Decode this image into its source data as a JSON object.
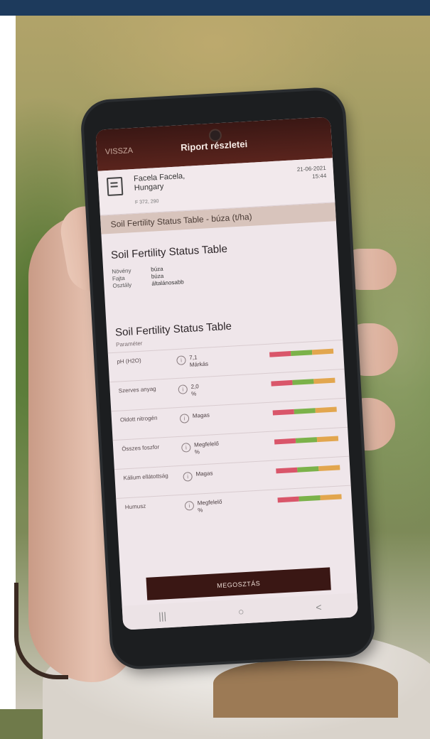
{
  "app": {
    "back_label": "VISSZA",
    "title": "Riport részletei"
  },
  "report": {
    "location_line1": "Facela Facela,",
    "location_line2": "Hungary",
    "coordinates": "F 372, 290",
    "date": "21-06-2021",
    "time": "15:44"
  },
  "section_header": "Soil Fertility Status Table - búza (t/ha)",
  "summary": {
    "title": "Soil Fertility Status Table",
    "rows": [
      {
        "key": "Növény",
        "value": "búza"
      },
      {
        "key": "Fajta",
        "value": "búza"
      },
      {
        "key": "Osztály",
        "value": "általánosabb"
      }
    ]
  },
  "table": {
    "title": "Soil Fertility Status Table",
    "column_label": "Paraméter",
    "rows": [
      {
        "name": "pH (H2O)",
        "value": "7,1\nMárkás"
      },
      {
        "name": "Szerves anyag",
        "value": "2,0\n%"
      },
      {
        "name": "Oldott nitrogén",
        "value": "Magas"
      },
      {
        "name": "Összes foszfor",
        "value": "Megfelelő\n%"
      },
      {
        "name": "Kálium ellátottság",
        "value": "Magas"
      },
      {
        "name": "Humusz",
        "value": "Megfelelő\n%"
      }
    ]
  },
  "button": {
    "label": "MEGOSZTÁS"
  },
  "navbar": {
    "recent": "|||",
    "home": "○",
    "back": "<"
  },
  "colors": {
    "scale_red": "#d9566a",
    "scale_green": "#7bb24a",
    "scale_orange": "#e2a64e",
    "appbar": "#3a1714"
  }
}
